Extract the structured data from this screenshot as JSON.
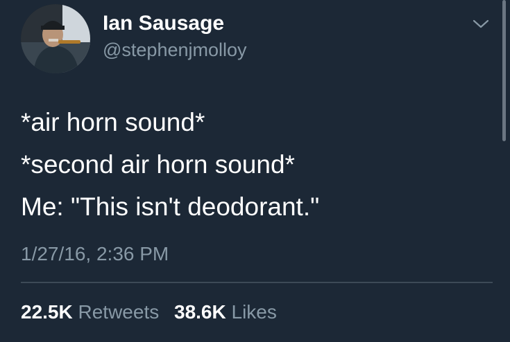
{
  "tweet": {
    "author": {
      "display_name": "Ian Sausage",
      "handle": "@stephenjmolloy",
      "avatar_icon": "profile-photo"
    },
    "menu_icon": "chevron-down-icon",
    "lines": [
      "*air horn sound*",
      "*second air horn sound*",
      "Me: \"This isn't deodorant.\""
    ],
    "timestamp": "1/27/16, 2:36 PM",
    "stats": {
      "retweets_count": "22.5K",
      "retweets_label": "Retweets",
      "likes_count": "38.6K",
      "likes_label": "Likes"
    }
  },
  "colors": {
    "background": "#1c2836",
    "primary_text": "#ffffff",
    "secondary_text": "#8899a6",
    "divider": "#3d4a57",
    "scrollbar": "#6b7682"
  }
}
